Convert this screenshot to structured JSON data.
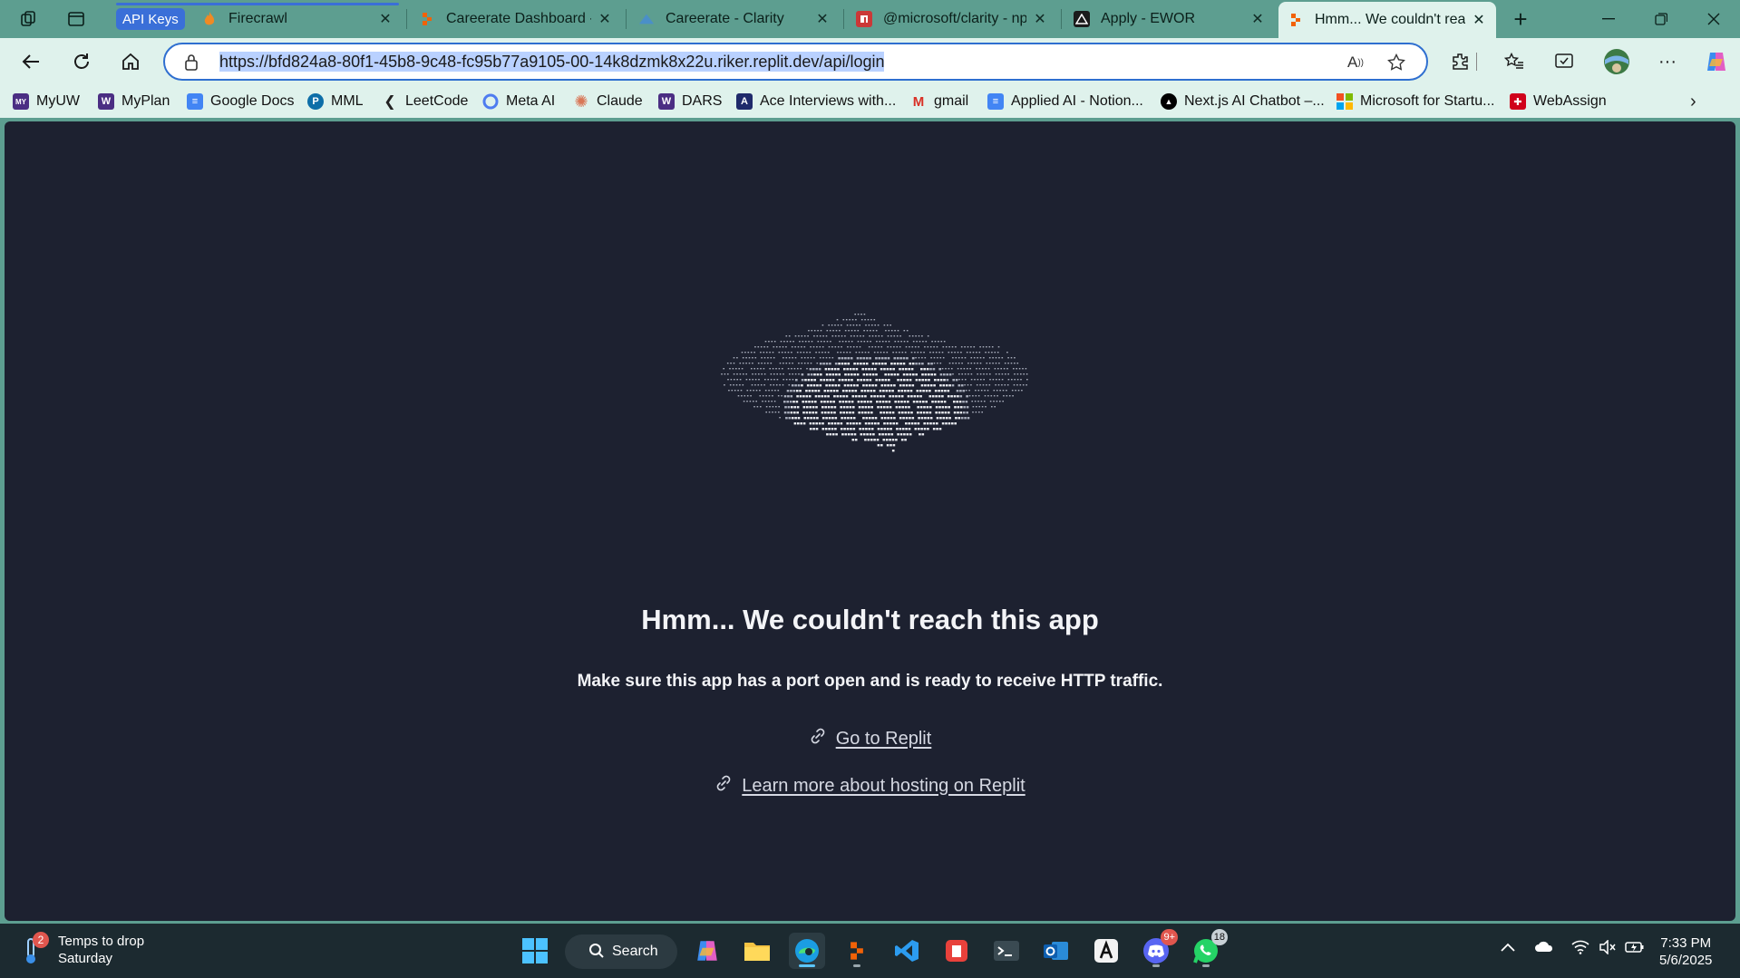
{
  "window": {
    "tabs": [
      {
        "label": "Firecrawl",
        "favicon": "firecrawl-flame-icon",
        "closable": true
      },
      {
        "label": "Careerate Dashboard - R",
        "favicon": "replit-icon",
        "closable": true
      },
      {
        "label": "Careerate - Clarity",
        "favicon": "clarity-icon",
        "closable": true
      },
      {
        "label": "@microsoft/clarity - npm",
        "favicon": "npm-icon",
        "closable": true
      },
      {
        "label": "Apply - EWOR",
        "favicon": "ewor-icon",
        "closable": true
      },
      {
        "label": "Hmm... We couldn't reach",
        "favicon": "replit-icon",
        "closable": true,
        "active": true
      }
    ],
    "tab_group_label": "API Keys",
    "tab_group_color": "#3a6fd8"
  },
  "address_bar": {
    "url": "https://bfd824a8-80f1-45b8-9c48-fc95b77a9105-00-14k8dzmk8x22u.riker.replit.dev/api/login"
  },
  "bookmarks": [
    {
      "label": "MyUW",
      "icon": "uw-icon"
    },
    {
      "label": "MyPlan",
      "icon": "uw-w-icon"
    },
    {
      "label": "Google Docs",
      "icon": "google-docs-icon"
    },
    {
      "label": "MML",
      "icon": "pearson-icon"
    },
    {
      "label": "LeetCode",
      "icon": "leetcode-icon"
    },
    {
      "label": "Meta AI",
      "icon": "meta-ai-icon"
    },
    {
      "label": "Claude",
      "icon": "claude-icon"
    },
    {
      "label": "DARS",
      "icon": "uw-w-icon"
    },
    {
      "label": "Ace Interviews with...",
      "icon": "ace-icon"
    },
    {
      "label": "gmail",
      "icon": "gmail-icon"
    },
    {
      "label": "Applied AI - Notion...",
      "icon": "docs-icon"
    },
    {
      "label": "Next.js AI Chatbot –...",
      "icon": "vercel-icon"
    },
    {
      "label": "Microsoft for Startu...",
      "icon": "microsoft-icon"
    },
    {
      "label": "WebAssign",
      "icon": "webassign-icon"
    }
  ],
  "page": {
    "headline": "Hmm... We couldn't reach this app",
    "subline": "Make sure this app has a port open and is ready to receive HTTP traffic.",
    "link_go": "Go to Replit",
    "link_learn": "Learn more about hosting on Replit",
    "background": "#1d2130"
  },
  "taskbar": {
    "weather_title": "Temps to drop",
    "weather_sub": "Saturday",
    "weather_badge": "2",
    "search_label": "Search",
    "discord_badge": "9+",
    "whatsapp_badge": "18",
    "time": "7:33 PM",
    "date": "5/6/2025"
  }
}
